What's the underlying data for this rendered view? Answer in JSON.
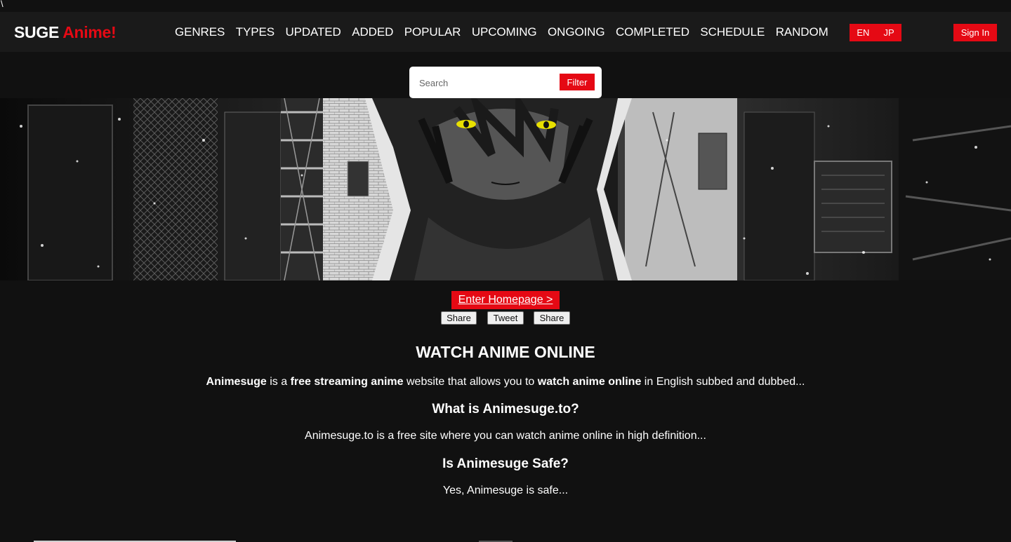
{
  "stray_char": "\\",
  "logo": {
    "part1": "SUGE",
    "part2": "Anime!"
  },
  "nav": [
    "GENRES",
    "TYPES",
    "UPDATED",
    "ADDED",
    "POPULAR",
    "UPCOMING",
    "ONGOING",
    "COMPLETED",
    "SCHEDULE",
    "RANDOM"
  ],
  "lang": {
    "en": "EN",
    "jp": "JP"
  },
  "signin_label": "Sign In",
  "search": {
    "placeholder": "Search",
    "filter_label": "Filter"
  },
  "enter_label": "Enter Homepage >",
  "share_buttons": [
    "Share",
    "Tweet",
    "Share"
  ],
  "content": {
    "title": "WATCH ANIME ONLINE",
    "intro": {
      "brand": "Animesuge",
      "t1": " is a ",
      "b1": "free streaming anime",
      "t2": " website that allows you to ",
      "b2": "watch anime online",
      "t3": " in English subbed and dubbed..."
    },
    "q1": "What is Animesuge.to?",
    "a1": "Animesuge.to is a free site where you can watch anime online in high definition...",
    "q2": "Is Animesuge Safe?",
    "a2": "Yes, Animesuge is safe..."
  },
  "colors": {
    "accent": "#e50914",
    "background": "#111111",
    "header": "#1a1a1a"
  },
  "icons": {
    "hero": "anime-hero-banner"
  }
}
